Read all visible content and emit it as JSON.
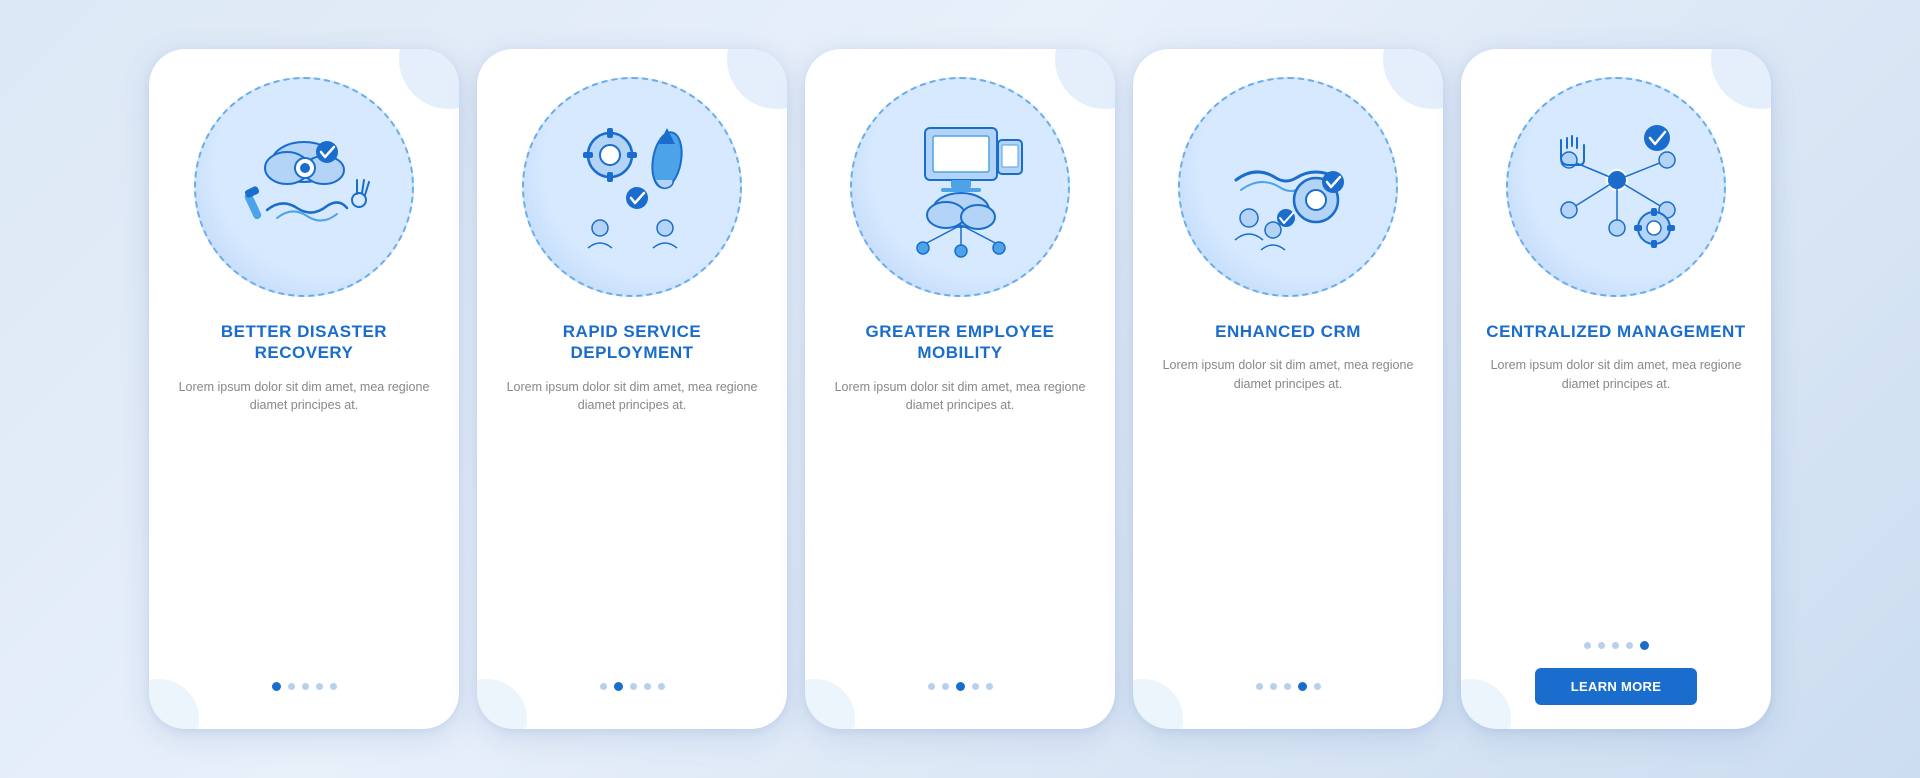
{
  "cards": [
    {
      "id": "card-1",
      "title": "BETTER DISASTER RECOVERY",
      "body": "Lorem ipsum dolor sit dim amet, mea regione diamet principes at.",
      "dots": [
        1,
        2,
        3,
        4,
        5
      ],
      "active_dot": 1,
      "show_button": false,
      "button_label": ""
    },
    {
      "id": "card-2",
      "title": "RAPID SERVICE DEPLOYMENT",
      "body": "Lorem ipsum dolor sit dim amet, mea regione diamet principes at.",
      "dots": [
        1,
        2,
        3,
        4,
        5
      ],
      "active_dot": 2,
      "show_button": false,
      "button_label": ""
    },
    {
      "id": "card-3",
      "title": "GREATER EMPLOYEE MOBILITY",
      "body": "Lorem ipsum dolor sit dim amet, mea regione diamet principes at.",
      "dots": [
        1,
        2,
        3,
        4,
        5
      ],
      "active_dot": 3,
      "show_button": false,
      "button_label": ""
    },
    {
      "id": "card-4",
      "title": "ENHANCED CRM",
      "body": "Lorem ipsum dolor sit dim amet, mea regione diamet principes at.",
      "dots": [
        1,
        2,
        3,
        4,
        5
      ],
      "active_dot": 4,
      "show_button": false,
      "button_label": ""
    },
    {
      "id": "card-5",
      "title": "CENTRALIZED MANAGEMENT",
      "body": "Lorem ipsum dolor sit dim amet, mea regione diamet principes at.",
      "dots": [
        1,
        2,
        3,
        4,
        5
      ],
      "active_dot": 5,
      "show_button": true,
      "button_label": "LEARN MORE"
    }
  ]
}
